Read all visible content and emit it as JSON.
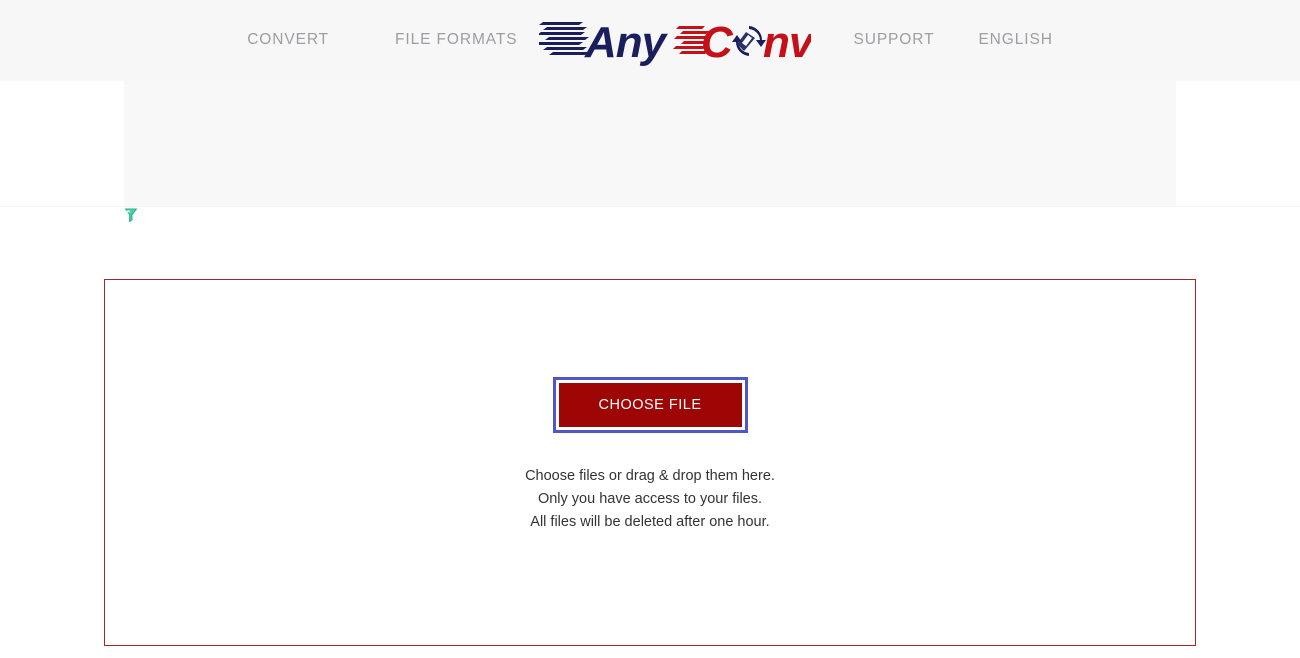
{
  "header": {
    "background_color": "#f7f7f8",
    "nav_left": [
      {
        "label": "CONVERT",
        "name": "nav-convert"
      },
      {
        "label": "FILE FORMATS",
        "name": "nav-file-formats"
      }
    ],
    "nav_right": [
      {
        "label": "SUPPORT",
        "name": "nav-support"
      },
      {
        "label": "ENGLISH",
        "name": "nav-english"
      }
    ],
    "logo": {
      "text_primary": "Any",
      "text_secondary": "Conv",
      "primary_color": "#1a1f5c",
      "secondary_color": "#c41119",
      "icon": "circular-arrows-icon",
      "alt": "AnyConv"
    }
  },
  "ad_band": {
    "label": "",
    "adchoices_icon": "adchoices-funnel-icon",
    "icon_color": "#3fbf9a"
  },
  "dropzone": {
    "border_color": "#9e2a2b",
    "button": {
      "label": "CHOOSE FILE",
      "fill_color": "#9e0505",
      "text_color": "#ffffff",
      "focus_ring_color": "#4f57c8"
    },
    "hint_lines": [
      "Choose files or drag & drop them here.",
      "Only you have access to your files.",
      "All files will be deleted after one hour."
    ]
  }
}
